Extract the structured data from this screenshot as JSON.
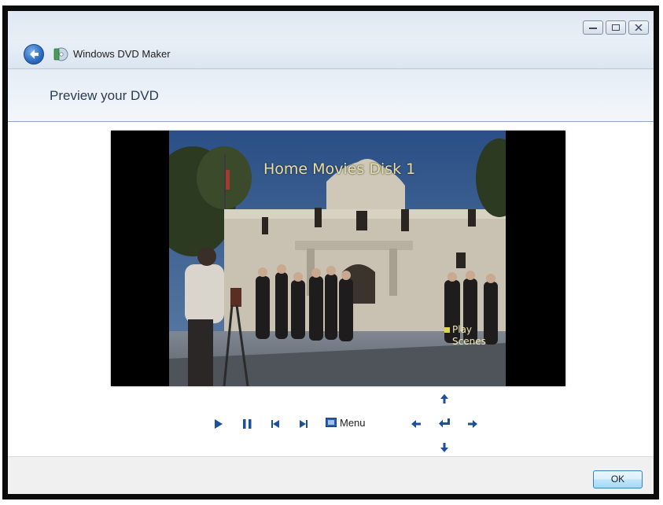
{
  "window": {
    "app_title": "Windows DVD Maker",
    "page_title": "Preview your DVD",
    "controls": [
      "minimize",
      "maximize",
      "close"
    ]
  },
  "preview": {
    "menu_title": "Home Movies Disk 1",
    "menu_item_line1": "Play",
    "menu_item_line2": "Scenes"
  },
  "playback": {
    "menu_label": "Menu",
    "icons": [
      "play-icon",
      "pause-icon",
      "previous-chapter-icon",
      "next-chapter-icon",
      "menu-icon",
      "arrow-up-icon",
      "arrow-left-icon",
      "enter-icon",
      "arrow-right-icon",
      "arrow-down-icon"
    ]
  },
  "footer": {
    "ok_label": "OK"
  },
  "colors": {
    "accent": "#1c4f9c",
    "header_bg": "#e6edf6",
    "menu_text": "#e6dfa6"
  }
}
